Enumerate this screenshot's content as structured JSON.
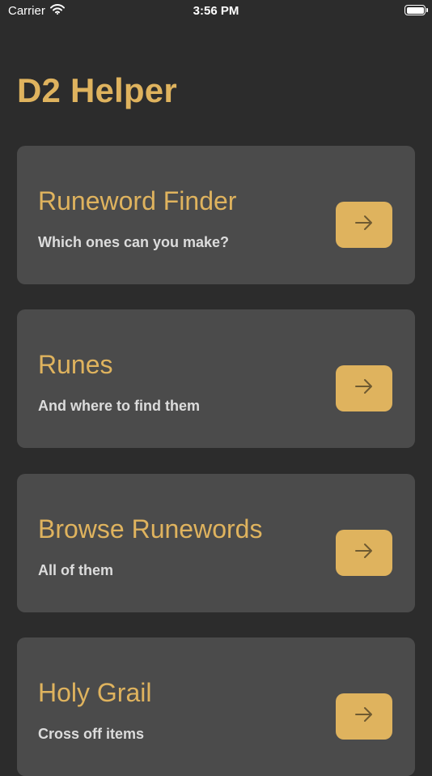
{
  "status_bar": {
    "carrier": "Carrier",
    "time": "3:56 PM"
  },
  "app": {
    "title": "D2 Helper"
  },
  "cards": [
    {
      "title": "Runeword Finder",
      "subtitle": "Which ones can you make?",
      "button_icon": "arrow-right-icon"
    },
    {
      "title": "Runes",
      "subtitle": "And where to find them",
      "button_icon": "arrow-right-icon"
    },
    {
      "title": "Browse Runewords",
      "subtitle": "All of them",
      "button_icon": "arrow-right-icon"
    },
    {
      "title": "Holy Grail",
      "subtitle": "Cross off items",
      "button_icon": "arrow-right-icon"
    }
  ],
  "colors": {
    "background": "#2c2c2c",
    "card": "#4b4b4b",
    "accent": "#dfb35e",
    "subtitle": "#dcdcdc"
  }
}
